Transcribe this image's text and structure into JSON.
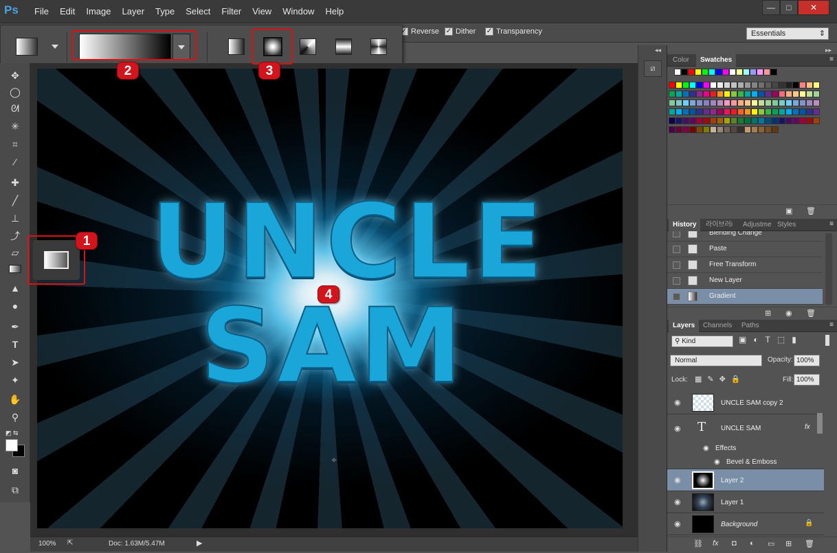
{
  "app": {
    "logo": "Ps"
  },
  "menu": [
    "File",
    "Edit",
    "Image",
    "Layer",
    "Type",
    "Select",
    "Filter",
    "View",
    "Window",
    "Help"
  ],
  "window_controls": {
    "minimize": "—",
    "maximize": "□",
    "close": "✕"
  },
  "options": {
    "reverse": "Reverse",
    "dither": "Dither",
    "transparency": "Transparency",
    "workspace": "Essentials"
  },
  "badges": {
    "one": "1",
    "two": "2",
    "three": "3",
    "four": "4"
  },
  "canvas": {
    "line1": "UNCLE",
    "line2": "SAM"
  },
  "status": {
    "zoom": "100%",
    "doc": "Doc: 1.63M/5.47M"
  },
  "swatch_panel": {
    "tabs": [
      "Color",
      "Swatches"
    ],
    "active": "Swatches"
  },
  "swatch_colors": [
    [
      "#ffffff",
      "#000000",
      "#ff0000",
      "#ffff00",
      "#00ff00",
      "#00ffff",
      "#0000ff",
      "#ff00ff",
      "#ffffff",
      "#ffff99",
      "#99ffff",
      "#9999ff",
      "#ff99ff",
      "#ff9999",
      "#000000"
    ],
    [
      "#ff0000",
      "#ffff00",
      "#00ff00",
      "#00ffff",
      "#0000ff",
      "#ff00ff",
      "#ffffff",
      "#ebebeb",
      "#d6d6d6",
      "#c2c2c2",
      "#adadad",
      "#999999",
      "#858585",
      "#707070",
      "#5c5c5c",
      "#474747",
      "#333333",
      "#1f1f1f",
      "#000000",
      "#ff8080",
      "#ffbf80",
      "#ffff80"
    ],
    [
      "#00a651",
      "#00a99d",
      "#0072bc",
      "#2e3192",
      "#92278f",
      "#ec008c",
      "#ed1c24",
      "#f7941d",
      "#fff200",
      "#8dc63f",
      "#39b54a",
      "#00a99d",
      "#00aeef",
      "#0054a6",
      "#662d91",
      "#9e005d",
      "#f26d7d",
      "#f9ad81",
      "#fdc68a",
      "#fff799",
      "#c4df9b",
      "#a3d39c"
    ],
    [
      "#82ca9c",
      "#7accc8",
      "#6dcff6",
      "#7da7d9",
      "#8393ca",
      "#8781bd",
      "#a187be",
      "#bd8cbf",
      "#f49ac2",
      "#f6989d",
      "#f9ad81",
      "#fdc68a",
      "#fff79a",
      "#c4df9b",
      "#a3d39c",
      "#82ca9c",
      "#7accc8",
      "#6dcff6",
      "#7da7d9",
      "#8393ca",
      "#a187be",
      "#bd8cbf"
    ],
    [
      "#00a99d",
      "#00aeef",
      "#0072bc",
      "#0054a6",
      "#2e3192",
      "#662d91",
      "#92278f",
      "#9e005d",
      "#ed145b",
      "#ed1c24",
      "#f26522",
      "#f7941d",
      "#fff200",
      "#8dc63f",
      "#39b54a",
      "#00a651",
      "#00a99d",
      "#00aeef",
      "#0072bc",
      "#0054a6",
      "#2e3192",
      "#662d91"
    ],
    [
      "#0d004c",
      "#1b1464",
      "#440e62",
      "#630460",
      "#9e0039",
      "#9e0b0f",
      "#a0410d",
      "#a36209",
      "#aba000",
      "#598527",
      "#197b30",
      "#007236",
      "#00746b",
      "#0076a3",
      "#004a80",
      "#003471",
      "#1b1464",
      "#440e62",
      "#630460",
      "#9e0039",
      "#9e0b0f",
      "#a0410d"
    ],
    [
      "#4b0049",
      "#660033",
      "#7b0046",
      "#790000",
      "#7d4900",
      "#827b00",
      "#c7b299",
      "#998675",
      "#736357",
      "#534741",
      "#362f2d",
      "#c69c6d",
      "#a67c52",
      "#8c6239",
      "#754c24",
      "#603913"
    ]
  ],
  "history_panel": {
    "tabs": [
      "History",
      "라이브러i",
      "Adjustme",
      "Styles"
    ],
    "active": "History"
  },
  "history": [
    "Blending Change",
    "Paste",
    "Free Transform",
    "New Layer",
    "Gradient"
  ],
  "layers_panel": {
    "tabs": [
      "Layers",
      "Channels",
      "Paths"
    ],
    "active": "Layers",
    "kind": "Kind",
    "blend": "Normal",
    "opacity_label": "Opacity:",
    "opacity": "100%",
    "lock_label": "Lock:",
    "fill_label": "Fill:",
    "fill": "100%"
  },
  "layers": [
    {
      "name": "UNCLE SAM copy 2"
    },
    {
      "name": "UNCLE SAM",
      "fx": "fx"
    },
    {
      "name": "Effects"
    },
    {
      "name": "Bevel & Emboss"
    },
    {
      "name": "Layer 2"
    },
    {
      "name": "Layer 1"
    },
    {
      "name": "Background"
    }
  ]
}
